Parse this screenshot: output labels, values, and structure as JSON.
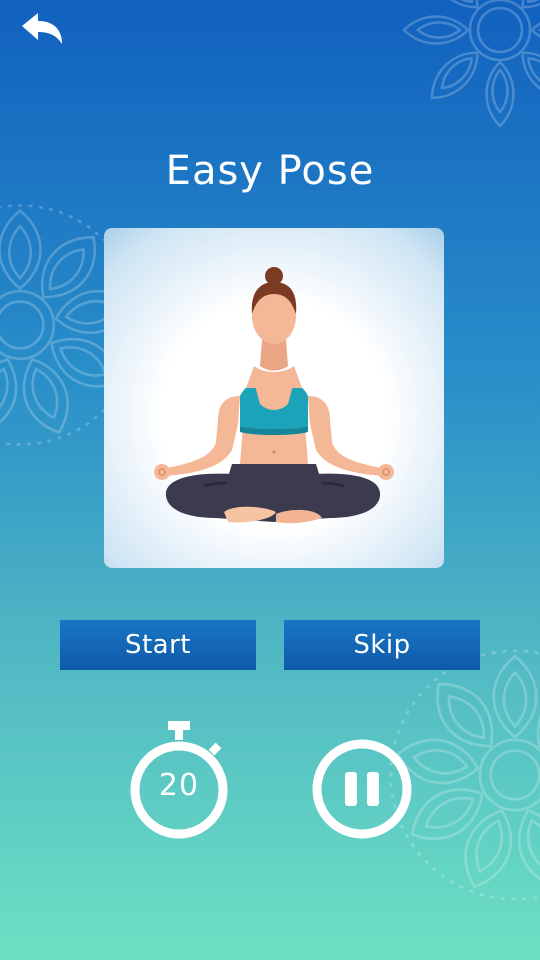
{
  "header": {
    "back_icon": "back-arrow-icon",
    "title": "Easy Pose"
  },
  "pose": {
    "illustration": "woman-meditating-easy-pose"
  },
  "actions": {
    "start_label": "Start",
    "skip_label": "Skip"
  },
  "timer": {
    "icon": "stopwatch-icon",
    "value": "20"
  },
  "controls": {
    "pause_icon": "pause-icon"
  },
  "colors": {
    "gradient_top": "#1161bf",
    "gradient_bottom": "#6de0c3",
    "button_blue": "#1268b6"
  }
}
